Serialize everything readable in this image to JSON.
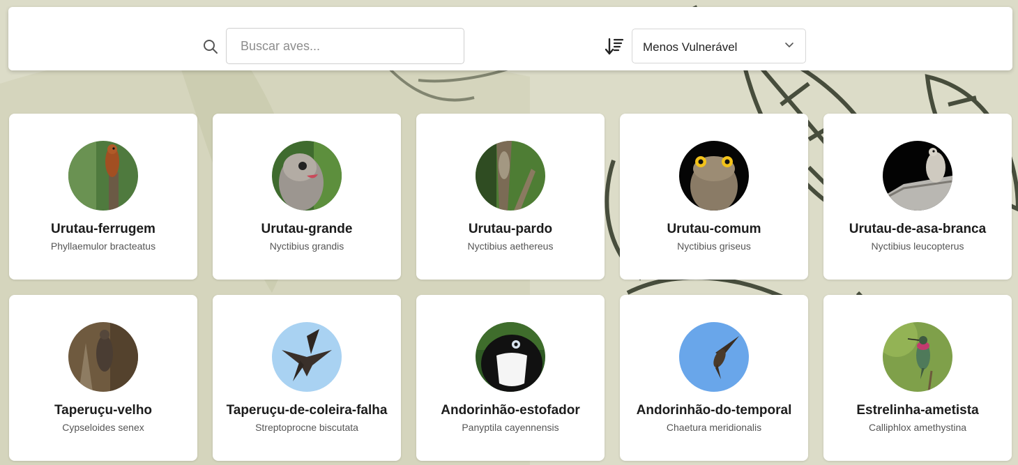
{
  "search": {
    "placeholder": "Buscar aves..."
  },
  "sort": {
    "selected": "Menos Vulnerável"
  },
  "birds": [
    {
      "name": "Urutau-ferrugem",
      "scientific": "Phyllaemulor bracteatus"
    },
    {
      "name": "Urutau-grande",
      "scientific": "Nyctibius grandis"
    },
    {
      "name": "Urutau-pardo",
      "scientific": "Nyctibius aethereus"
    },
    {
      "name": "Urutau-comum",
      "scientific": "Nyctibius griseus"
    },
    {
      "name": "Urutau-de-asa-branca",
      "scientific": "Nyctibius leucopterus"
    },
    {
      "name": "Taperuçu-velho",
      "scientific": "Cypseloides senex"
    },
    {
      "name": "Taperuçu-de-coleira-falha",
      "scientific": "Streptoprocne biscutata"
    },
    {
      "name": "Andorinhão-estofador",
      "scientific": "Panyptila cayennensis"
    },
    {
      "name": "Andorinhão-do-temporal",
      "scientific": "Chaetura meridionalis"
    },
    {
      "name": "Estrelinha-ametista",
      "scientific": "Calliphlox amethystina"
    }
  ]
}
